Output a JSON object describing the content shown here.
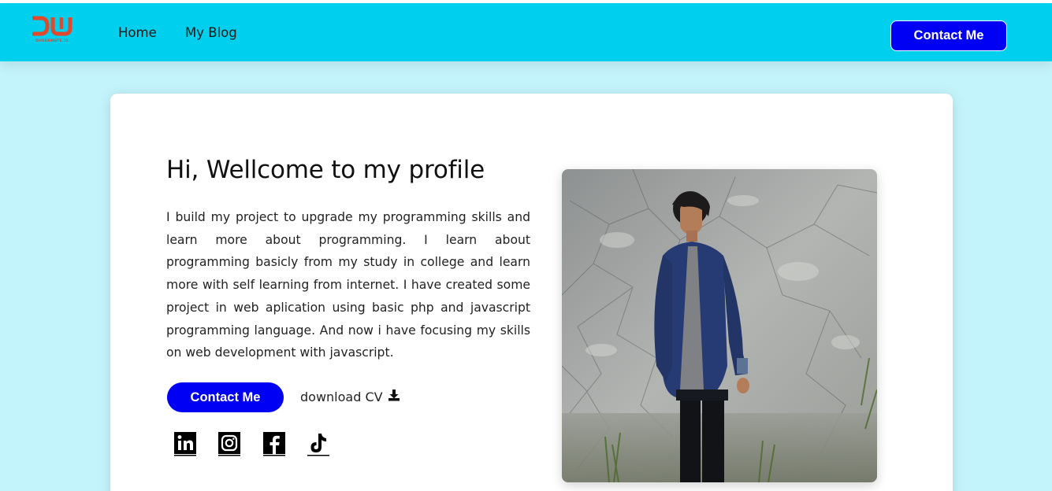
{
  "nav": {
    "logo_mark": "DW",
    "logo_text": "DUSERMATE.ID",
    "home": "Home",
    "blog": "My Blog",
    "contact": "Contact Me"
  },
  "hero": {
    "title": "Hi, Wellcome to my profile",
    "description": "I build my project to upgrade my programming skills and learn more about programming. I learn about programming basicly from my study in college and learn more with self learning from internet. I have created some project in web aplication using basic php and javascript programming language. And now i have focusing my skills on web development with javascript.",
    "contact_button": "Contact Me",
    "download_label": "download CV"
  },
  "social": [
    "linkedin-icon",
    "instagram-icon",
    "facebook-icon",
    "tiktok-icon"
  ],
  "colors": {
    "background": "#c3f3fb",
    "navbar": "#00cfee",
    "accent": "#0000f4",
    "logo": "#e0492c"
  }
}
